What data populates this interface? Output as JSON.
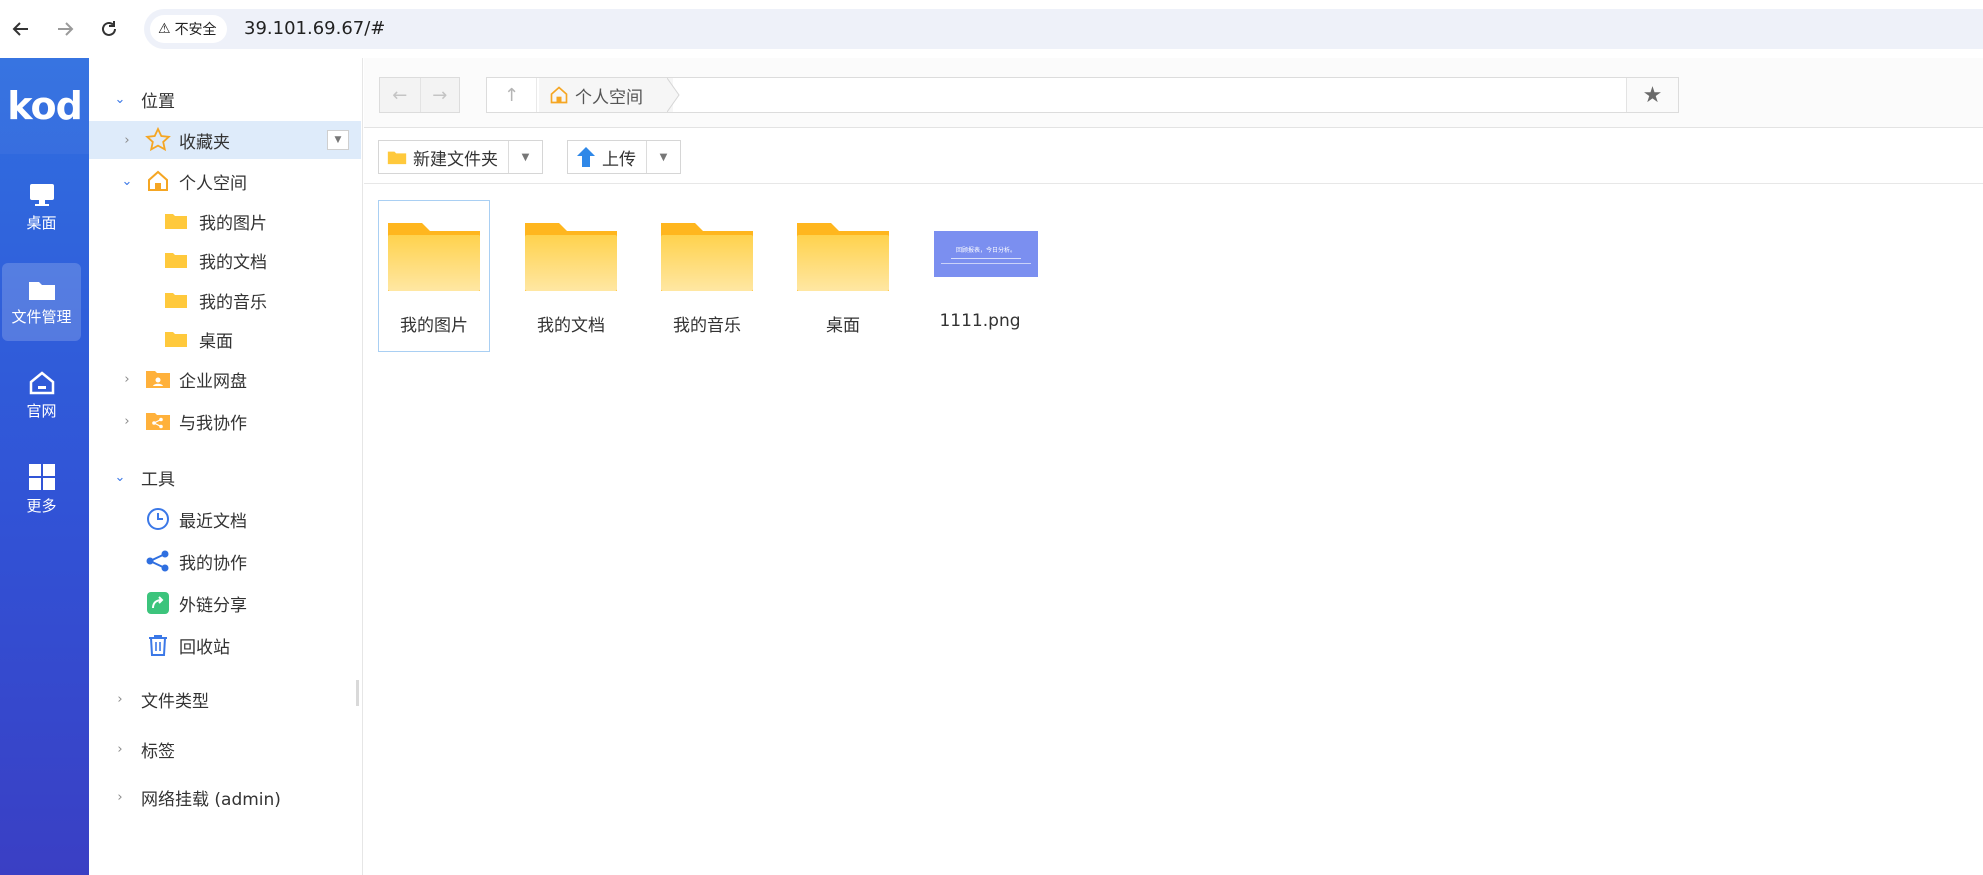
{
  "browser": {
    "security_label": "不安全",
    "url": "39.101.69.67/#"
  },
  "rail": {
    "logo": "kod",
    "items": [
      {
        "label": "桌面",
        "icon": "monitor-icon"
      },
      {
        "label": "文件管理",
        "icon": "folder-icon",
        "active": true
      },
      {
        "label": "官网",
        "icon": "home-icon"
      },
      {
        "label": "更多",
        "icon": "grid-icon"
      }
    ]
  },
  "sidebar": {
    "location_header": "位置",
    "favorites": "收藏夹",
    "personal_space": "个人空间",
    "personal_children": [
      "我的图片",
      "我的文档",
      "我的音乐",
      "桌面"
    ],
    "enterprise": "企业网盘",
    "shared_with_me": "与我协作",
    "tools_header": "工具",
    "tools": [
      "最近文档",
      "我的协作",
      "外链分享",
      "回收站"
    ],
    "file_types": "文件类型",
    "tags": "标签",
    "network_mount": "网络挂载 (admin)"
  },
  "pathbar": {
    "crumb": "个人空间"
  },
  "toolbar": {
    "new_folder": "新建文件夹",
    "upload": "上传"
  },
  "files": [
    {
      "name": "我的图片",
      "type": "folder",
      "selected": true
    },
    {
      "name": "我的文档",
      "type": "folder"
    },
    {
      "name": "我的音乐",
      "type": "folder"
    },
    {
      "name": "桌面",
      "type": "folder"
    },
    {
      "name": "1111.png",
      "type": "image",
      "thumb_text": "回顾报表，今日分析。"
    }
  ],
  "colors": {
    "rail_top": "#2f6fe0",
    "rail_bottom": "#3a3fc4",
    "folder": "#ffc93c",
    "selection": "#deebfa",
    "accent": "#3b78e7"
  }
}
